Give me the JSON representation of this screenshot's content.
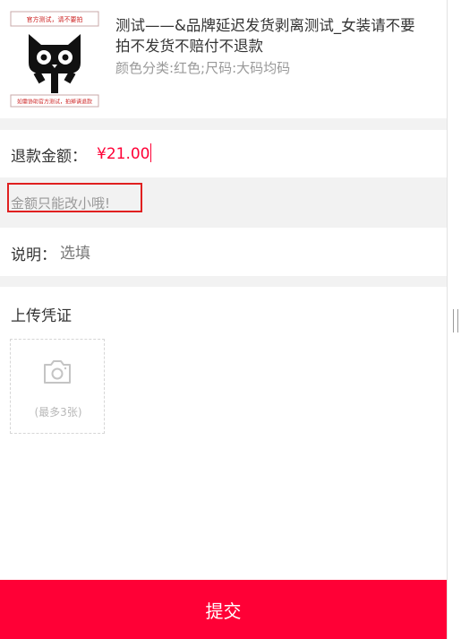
{
  "product": {
    "title": "测试——&品牌延迟发货剥离测试_女装请不要拍不发货不赔付不退款",
    "spec": "颜色分类:红色;尺码:大码均码",
    "image": {
      "top_text": "官方测试，请不要拍",
      "bottom_text": "如需协助官方测试，拍掉请退款"
    }
  },
  "refund": {
    "label": "退款金额：",
    "amount": "¥21.00"
  },
  "hint": {
    "text": "金额只能改小哦!"
  },
  "note": {
    "label": "说明：",
    "placeholder": "选填"
  },
  "upload": {
    "title": "上传凭证",
    "limit_text": "(最多3张)"
  },
  "submit": {
    "label": "提交"
  },
  "colors": {
    "accent": "#ff0036",
    "highlight_border": "#e02020"
  }
}
